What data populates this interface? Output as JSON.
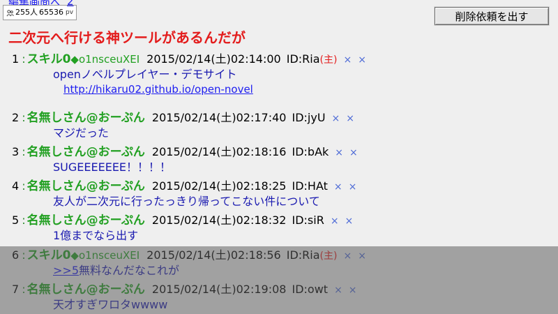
{
  "counter": {
    "users": "255人",
    "views": "65536",
    "unit": "pv"
  },
  "top_link": "編集画面へ",
  "top_link_right": "2",
  "delete_button": "削除依頼を出す",
  "thread_title": "二次元へ行ける神ツールがあるんだが",
  "delete_mark": "×",
  "owner_mark": "(主)",
  "posts": [
    {
      "num": "1",
      "name": "スキル0",
      "trip": "◆o1nsceuXEI",
      "date": "2015/02/14(土)02:14:00",
      "id": "ID:Ria",
      "owner": true,
      "body": "openノベルプレイヤー・デモサイト",
      "link": "http://hikaru02.github.io/open-novel"
    },
    {
      "num": "2",
      "name": "名無しさん@おーぷん",
      "trip": "",
      "date": "2015/02/14(土)02:17:40",
      "id": "ID:jyU",
      "owner": false,
      "body": "マジだった"
    },
    {
      "num": "3",
      "name": "名無しさん@おーぷん",
      "trip": "",
      "date": "2015/02/14(土)02:18:16",
      "id": "ID:bAk",
      "owner": false,
      "body": "SUGEEEEEEE！！！！"
    },
    {
      "num": "4",
      "name": "名無しさん@おーぷん",
      "trip": "",
      "date": "2015/02/14(土)02:18:25",
      "id": "ID:HAt",
      "owner": false,
      "body": "友人が二次元に行ったっきり帰ってこない件について"
    },
    {
      "num": "5",
      "name": "名無しさん@おーぷん",
      "trip": "",
      "date": "2015/02/14(土)02:18:32",
      "id": "ID:siR",
      "owner": false,
      "body": "1億までなら出す"
    },
    {
      "num": "6",
      "name": "スキル0",
      "trip": "◆o1nsceuXEI",
      "date": "2015/02/14(土)02:18:56",
      "id": "ID:Ria",
      "owner": true,
      "anchor": ">>5",
      "body": "無料なんだなこれが"
    },
    {
      "num": "7",
      "name": "名無しさん@おーぷん",
      "trip": "",
      "date": "2015/02/14(土)02:19:08",
      "id": "ID:owt",
      "owner": false,
      "body": "天才すぎワロタwwww"
    }
  ]
}
